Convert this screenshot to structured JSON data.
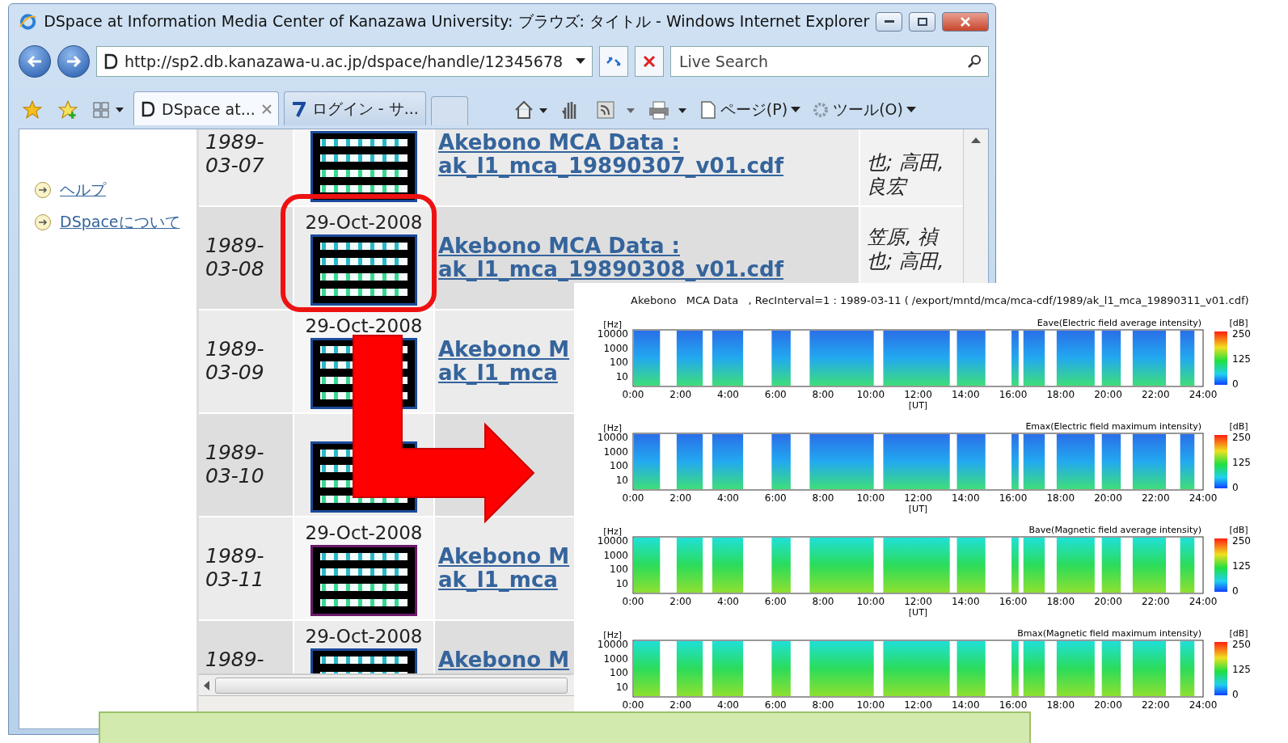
{
  "window": {
    "title": "DSpace at Information Media Center of Kanazawa University: ブラウズ: タイトル - Windows Internet Explorer"
  },
  "address_bar": {
    "url": "http://sp2.db.kanazawa-u.ac.jp/dspace/handle/12345678"
  },
  "search": {
    "placeholder": "Live Search"
  },
  "tabs": [
    {
      "label": "DSpace at...",
      "selected": true
    },
    {
      "label": "ログイン - サ...",
      "selected": false
    }
  ],
  "toolbar": [
    "ページ(P)",
    "ツール(O)"
  ],
  "sidebar": {
    "items": [
      "ヘルプ",
      "DSpaceについて"
    ]
  },
  "rows": [
    {
      "date": "1989-03-07",
      "thumbnail": {
        "color": "#1a4a9a"
      },
      "title": "Akebono MCA Data :",
      "file": "ak_l1_mca_19890307_v01.cdf",
      "authors": "也; 高田, 良宏"
    },
    {
      "date": "1989-03-08",
      "thumbnail": {
        "date": "29-Oct-2008",
        "color": "#1a4a9a"
      },
      "title": "Akebono MCA Data :",
      "file": "ak_l1_mca_19890308_v01.cdf",
      "authors": "笠原, 禎也; 高田,"
    },
    {
      "date": "1989-03-09",
      "thumbnail": {
        "date": "29-Oct-2008",
        "color": "#1a4a9a"
      },
      "title": "Akebono M",
      "file": "ak_l1_mca"
    },
    {
      "date": "1989-03-10",
      "thumbnail": {
        "color": "#1a4a9a"
      }
    },
    {
      "date": "1989-03-11",
      "thumbnail": {
        "date": "29-Oct-2008",
        "color": "#6a1a6a"
      },
      "title": "Akebono M",
      "file": "ak_l1_mca"
    },
    {
      "date": "1989-",
      "thumbnail": {
        "date": "29-Oct-2008",
        "color": "#1a4a9a"
      },
      "title": "Akebono M"
    }
  ],
  "plot_panel": {
    "title": "Akebono   MCA Data   , RecInterval=1 : 1989-03-11 ( /export/mntd/mca/mca-cdf/1989/ak_l1_mca_19890311_v01.cdf)",
    "plots": [
      {
        "kind": "electric",
        "label": "Eave(Electric field average intensity)",
        "yunit": "[Hz]",
        "yticks": [
          "10000",
          "1000",
          "100",
          "10"
        ],
        "xticks": [
          "0:00",
          "2:00",
          "4:00",
          "6:00",
          "8:00",
          "10:00",
          "12:00",
          "14:00",
          "16:00",
          "18:00",
          "20:00",
          "22:00",
          "24:00"
        ],
        "xlabel": "[UT]",
        "scale_unit": "[dB]",
        "scale_ticks": [
          "250",
          "125",
          "0"
        ]
      },
      {
        "kind": "electric",
        "label": "Emax(Electric field maximum intensity)",
        "yunit": "[Hz]",
        "yticks": [
          "10000",
          "1000",
          "100",
          "10"
        ],
        "xticks": [
          "0:00",
          "2:00",
          "4:00",
          "6:00",
          "8:00",
          "10:00",
          "12:00",
          "14:00",
          "16:00",
          "18:00",
          "20:00",
          "22:00",
          "24:00"
        ],
        "xlabel": "[UT]",
        "scale_unit": "[dB]",
        "scale_ticks": [
          "250",
          "125",
          "0"
        ]
      },
      {
        "kind": "magnetic",
        "label": "Bave(Magnetic field average intensity)",
        "yunit": "[Hz]",
        "yticks": [
          "10000",
          "1000",
          "100",
          "10"
        ],
        "xticks": [
          "0:00",
          "2:00",
          "4:00",
          "6:00",
          "8:00",
          "10:00",
          "12:00",
          "14:00",
          "16:00",
          "18:00",
          "20:00",
          "22:00",
          "24:00"
        ],
        "xlabel": "[UT]",
        "scale_unit": "[dB]",
        "scale_ticks": [
          "250",
          "125",
          "0"
        ]
      },
      {
        "kind": "magnetic",
        "label": "Bmax(Magnetic field maximum intensity)",
        "yunit": "[Hz]",
        "yticks": [
          "10000",
          "1000",
          "100",
          "10"
        ],
        "xticks": [
          "0:00",
          "2:00",
          "4:00",
          "6:00",
          "8:00",
          "10:00",
          "12:00",
          "14:00",
          "16:00",
          "18:00",
          "20:00",
          "22:00",
          "24:00"
        ],
        "scale_unit": "[dB]",
        "scale_ticks": [
          "250",
          "125",
          "0"
        ]
      }
    ]
  }
}
